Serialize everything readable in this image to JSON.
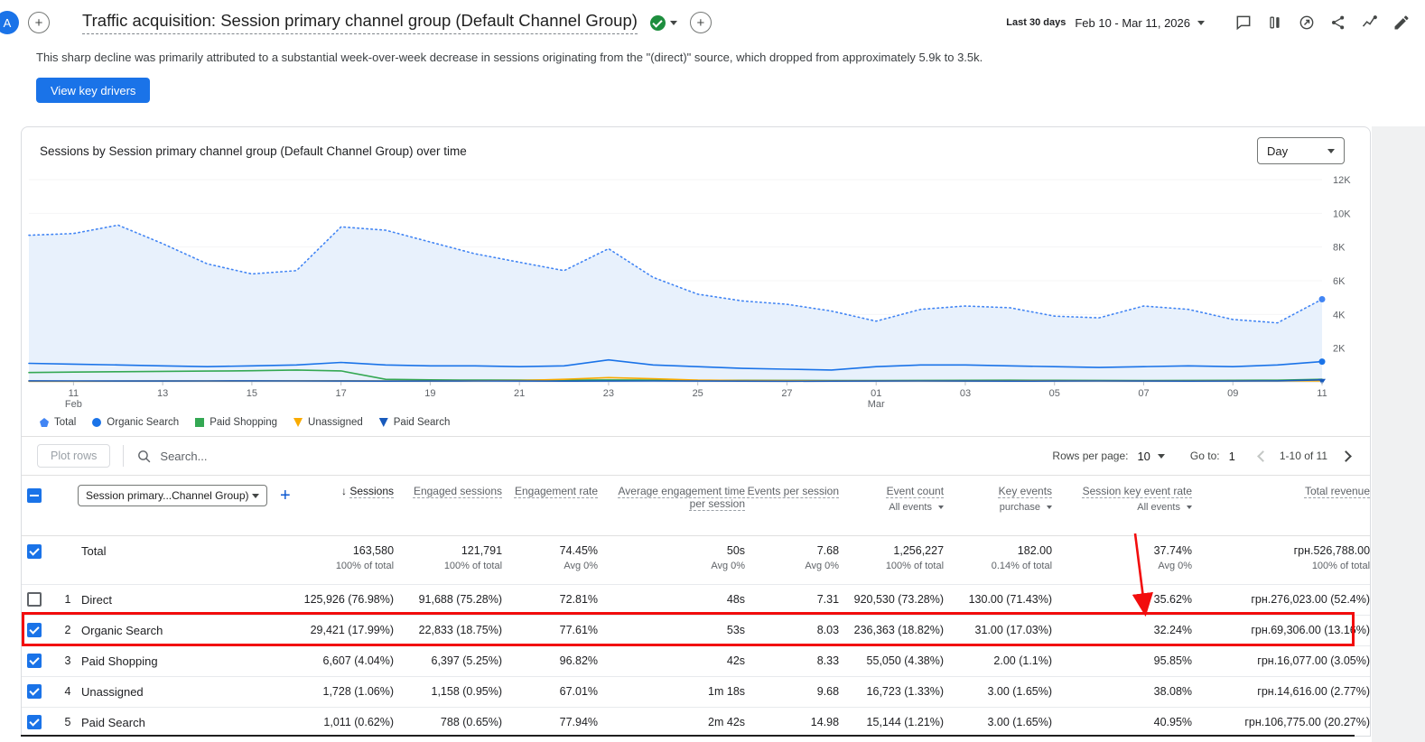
{
  "topbar": {
    "avatar": "A",
    "title": "Traffic acquisition: Session primary channel group (Default Channel Group)",
    "date_label": "Last 30 days",
    "date_range": "Feb 10 - Mar 11, 2026"
  },
  "insight": {
    "text": "This sharp decline was primarily attributed to a substantial week-over-week decrease in sessions originating from the \"(direct)\" source, which dropped from approximately 5.9k to 3.5k.",
    "button_label": "View key drivers"
  },
  "chart_data": {
    "type": "line",
    "title": "Sessions by Session primary channel group (Default Channel Group) over time",
    "granularity": "Day",
    "ylim": [
      0,
      12000
    ],
    "yticks": [
      {
        "v": 2000,
        "label": "2K"
      },
      {
        "v": 4000,
        "label": "4K"
      },
      {
        "v": 6000,
        "label": "6K"
      },
      {
        "v": 8000,
        "label": "8K"
      },
      {
        "v": 10000,
        "label": "10K"
      },
      {
        "v": 12000,
        "label": "12K"
      }
    ],
    "xticks": [
      {
        "i": 1,
        "label": "11",
        "sub": "Feb"
      },
      {
        "i": 3,
        "label": "13"
      },
      {
        "i": 5,
        "label": "15"
      },
      {
        "i": 7,
        "label": "17"
      },
      {
        "i": 9,
        "label": "19"
      },
      {
        "i": 11,
        "label": "21"
      },
      {
        "i": 13,
        "label": "23"
      },
      {
        "i": 15,
        "label": "25"
      },
      {
        "i": 17,
        "label": "27"
      },
      {
        "i": 19,
        "label": "01",
        "sub": "Mar"
      },
      {
        "i": 21,
        "label": "03"
      },
      {
        "i": 23,
        "label": "05"
      },
      {
        "i": 25,
        "label": "07"
      },
      {
        "i": 27,
        "label": "09"
      },
      {
        "i": 29,
        "label": "11"
      }
    ],
    "series": [
      {
        "name": "Total",
        "color": "#4285f4",
        "dashed": true,
        "area": true,
        "end_dot": true,
        "values": [
          8700,
          8800,
          9300,
          8200,
          7000,
          6400,
          6600,
          9200,
          9000,
          8300,
          7600,
          7100,
          6600,
          7900,
          6200,
          5200,
          4800,
          4600,
          4200,
          3600,
          4300,
          4500,
          4400,
          3900,
          3800,
          4500,
          4300,
          3700,
          3500,
          4900
        ]
      },
      {
        "name": "Organic Search",
        "color": "#1a73e8",
        "end_dot": true,
        "values": [
          1100,
          1050,
          1000,
          950,
          900,
          950,
          1000,
          1150,
          1000,
          950,
          950,
          900,
          950,
          1300,
          1000,
          900,
          800,
          750,
          700,
          900,
          1000,
          1000,
          950,
          900,
          850,
          900,
          950,
          900,
          1000,
          1200
        ]
      },
      {
        "name": "Paid Shopping",
        "color": "#34a853",
        "values": [
          550,
          580,
          600,
          620,
          640,
          660,
          700,
          650,
          150,
          120,
          100,
          100,
          100,
          110,
          100,
          90,
          90,
          85,
          80,
          80,
          85,
          90,
          95,
          90,
          85,
          80,
          85,
          90,
          95,
          150
        ]
      },
      {
        "name": "Unassigned",
        "color": "#f9ab00",
        "values": [
          40,
          40,
          45,
          50,
          50,
          55,
          60,
          60,
          55,
          50,
          60,
          80,
          150,
          250,
          180,
          100,
          80,
          70,
          60,
          60,
          55,
          50,
          55,
          60,
          55,
          50,
          55,
          60,
          55,
          60
        ]
      },
      {
        "name": "Paid Search",
        "color": "#185abc",
        "end_marker": "triangle",
        "values": [
          60,
          55,
          50,
          50,
          55,
          60,
          55,
          50,
          45,
          50,
          55,
          50,
          45,
          50,
          55,
          50,
          45,
          40,
          45,
          50,
          55,
          50,
          45,
          50,
          55,
          50,
          45,
          50,
          60,
          120
        ]
      }
    ]
  },
  "legend": [
    {
      "label": "Total",
      "color": "#4285f4",
      "shape": "pentagon"
    },
    {
      "label": "Organic Search",
      "color": "#1a73e8",
      "shape": "circle"
    },
    {
      "label": "Paid Shopping",
      "color": "#34a853",
      "shape": "square"
    },
    {
      "label": "Unassigned",
      "color": "#f9ab00",
      "shape": "triangle-down"
    },
    {
      "label": "Paid Search",
      "color": "#185abc",
      "shape": "triangle-down"
    }
  ],
  "toolbar": {
    "plot_rows_label": "Plot rows",
    "search_placeholder": "Search...",
    "rows_per_page_label": "Rows per page:",
    "rows_per_page_value": "10",
    "goto_label": "Go to:",
    "goto_value": "1",
    "page_range": "1-10 of 11"
  },
  "table": {
    "dimension_selector": "Session primary...Channel Group)",
    "columns": [
      {
        "label": "Sessions",
        "sorted": true
      },
      {
        "label": "Engaged sessions"
      },
      {
        "label": "Engagement rate"
      },
      {
        "label": "Average engagement time per session"
      },
      {
        "label": "Events per session"
      },
      {
        "label": "Event count",
        "sub": "All events"
      },
      {
        "label": "Key events",
        "sub": "purchase"
      },
      {
        "label": "Session key event rate",
        "sub": "All events"
      },
      {
        "label": "Total revenue"
      }
    ],
    "total_row": {
      "label": "Total",
      "checked": true,
      "cells": [
        {
          "v": "163,580",
          "s": "100% of total"
        },
        {
          "v": "121,791",
          "s": "100% of total"
        },
        {
          "v": "74.45%",
          "s": "Avg 0%"
        },
        {
          "v": "50s",
          "s": "Avg 0%"
        },
        {
          "v": "7.68",
          "s": "Avg 0%"
        },
        {
          "v": "1,256,227",
          "s": "100% of total"
        },
        {
          "v": "182.00",
          "s": "0.14% of total"
        },
        {
          "v": "37.74%",
          "s": "Avg 0%"
        },
        {
          "v": "грн.526,788.00",
          "s": "100% of total"
        }
      ]
    },
    "rows": [
      {
        "num": "1",
        "label": "Direct",
        "checked": false,
        "cells": [
          "125,926 (76.98%)",
          "91,688 (75.28%)",
          "72.81%",
          "48s",
          "7.31",
          "920,530 (73.28%)",
          "130.00 (71.43%)",
          "35.62%",
          "грн.276,023.00 (52.4%)"
        ]
      },
      {
        "num": "2",
        "label": "Organic Search",
        "checked": true,
        "highlighted": true,
        "cells": [
          "29,421 (17.99%)",
          "22,833 (18.75%)",
          "77.61%",
          "53s",
          "8.03",
          "236,363 (18.82%)",
          "31.00 (17.03%)",
          "32.24%",
          "грн.69,306.00 (13.16%)"
        ]
      },
      {
        "num": "3",
        "label": "Paid Shopping",
        "checked": true,
        "cells": [
          "6,607 (4.04%)",
          "6,397 (5.25%)",
          "96.82%",
          "42s",
          "8.33",
          "55,050 (4.38%)",
          "2.00 (1.1%)",
          "95.85%",
          "грн.16,077.00 (3.05%)"
        ]
      },
      {
        "num": "4",
        "label": "Unassigned",
        "checked": true,
        "cells": [
          "1,728 (1.06%)",
          "1,158 (0.95%)",
          "67.01%",
          "1m 18s",
          "9.68",
          "16,723 (1.33%)",
          "3.00 (1.65%)",
          "38.08%",
          "грн.14,616.00 (2.77%)"
        ]
      },
      {
        "num": "5",
        "label": "Paid Search",
        "checked": true,
        "cells": [
          "1,011 (0.62%)",
          "788 (0.65%)",
          "77.94%",
          "2m 42s",
          "14.98",
          "15,144 (1.21%)",
          "3.00 (1.65%)",
          "40.95%",
          "грн.106,775.00 (20.27%)"
        ]
      }
    ]
  }
}
